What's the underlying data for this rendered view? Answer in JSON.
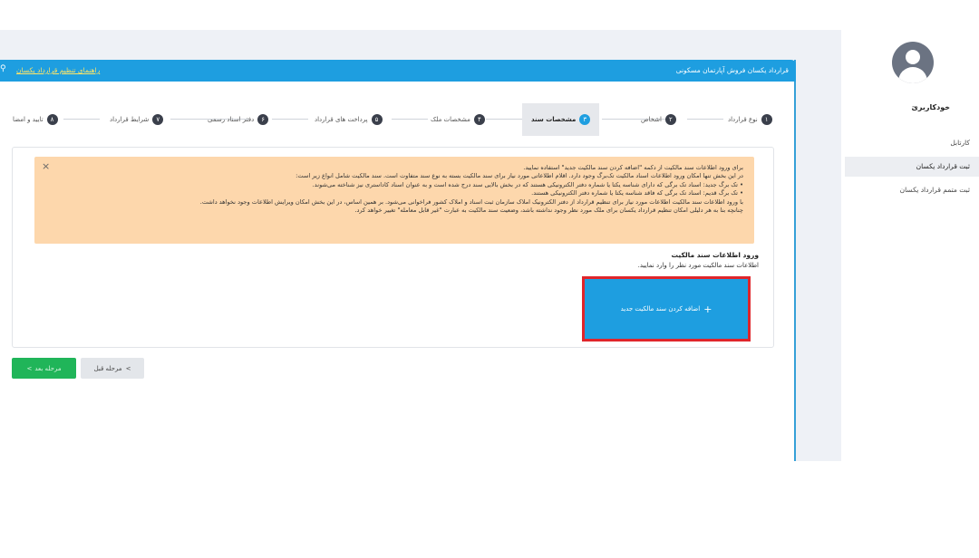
{
  "header": {
    "title": "قرارداد یکسان فروش آپارتمان مسکونی",
    "help_link": "راهنمای تنظیم قرارداد یکسان",
    "help_icon": "search-icon"
  },
  "sidebar": {
    "user_name": "خودکاربری",
    "user_dash": "-",
    "items": [
      {
        "label": "کارتابل"
      },
      {
        "label": "ثبت قرارداد یکسان"
      },
      {
        "label": "ثبت متمم قرارداد یکسان"
      }
    ]
  },
  "steps": [
    {
      "num": "۱",
      "label": "نوع قرارداد"
    },
    {
      "num": "۲",
      "label": "اشخاص"
    },
    {
      "num": "۳",
      "label": "مشخصات سند"
    },
    {
      "num": "۴",
      "label": "مشخصات ملک"
    },
    {
      "num": "۵",
      "label": "پرداخت های قرارداد"
    },
    {
      "num": "۶",
      "label": "دفتر اسناد رسمی"
    },
    {
      "num": "۷",
      "label": "شرایط قرارداد"
    },
    {
      "num": "۸",
      "label": "تایید و امضا"
    }
  ],
  "alert": {
    "close": "×",
    "lines": [
      "برای ورود اطلاعات سند مالکیت از دکمه \"اضافه کردن سند مالکیت جدید\" استفاده نمایید.",
      "در این بخش تنها امکان ورود اطلاعات اسناد مالکیت تک‌برگ وجود دارد. اقلام اطلاعاتی مورد نیاز برای سند مالکیت بسته به نوع سند متفاوت است. سند مالکیت شامل انواع زیر است:",
      "• تک برگ جدید: اسناد تک برگی که دارای شناسه یکتا یا شماره دفتر الکترونیکی هستند که در بخش بالایی سند درج شده است و به عنوان اسناد کاداستری نیز شناخته می‌شوند.",
      "• تک برگ قدیم: اسناد تک برگی که فاقد شناسه یکتا یا شماره دفتر الکترونیکی هستند.",
      "با ورود اطلاعات سند مالکیت اطلاعات مورد نیاز برای تنظیم قرارداد از دفتر الکترونیک املاک سازمان ثبت اسناد و املاک کشور فراخوانی می‌شود. بر همین اساس، در این بخش امکان ویرایش اطلاعات وجود نخواهد داشت.",
      "چنانچه بنا به هر دلیلی امکان تنظیم قرارداد یکسان برای ملک مورد نظر وجود نداشته باشد، وضعیت سند مالکیت به عبارت \"غیر قابل معامله\" تغییر خواهد کرد."
    ]
  },
  "section": {
    "title": "ورود اطلاعات سند مالکیت",
    "desc": "اطلاعات سند مالکیت مورد نظر را وارد نمایید."
  },
  "add_button": {
    "plus": "+",
    "label": "اضافه کردن سند مالکیت جدید"
  },
  "nav": {
    "next_label": "مرحله بعد",
    "next_icon": ">",
    "prev_label": "مرحله قبل",
    "prev_icon": ">"
  }
}
